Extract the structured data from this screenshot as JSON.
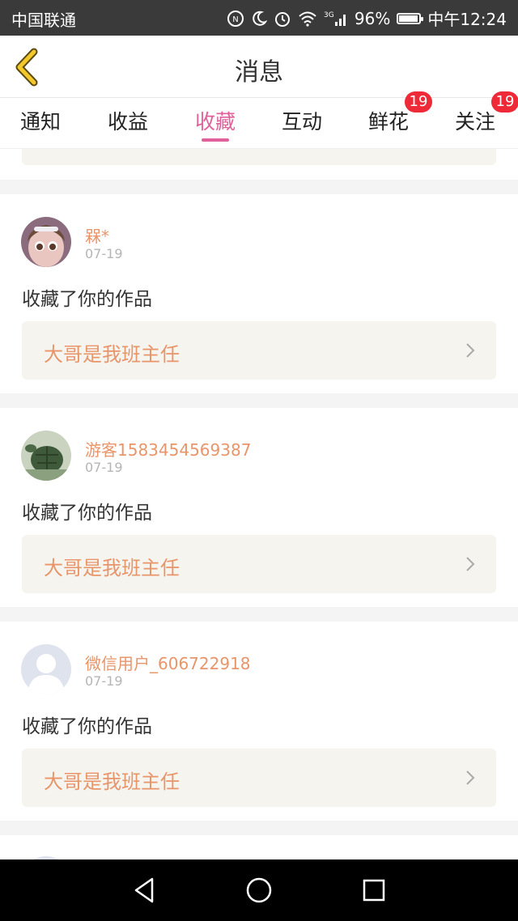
{
  "status_bar": {
    "carrier": "中国联通",
    "network": "3G",
    "battery": "96%",
    "battery_level": 0.96,
    "time": "中午12:24"
  },
  "header": {
    "title": "消息"
  },
  "tabs": [
    {
      "label": "通知",
      "badge": ""
    },
    {
      "label": "收益",
      "badge": ""
    },
    {
      "label": "收藏",
      "badge": "",
      "active": true
    },
    {
      "label": "互动",
      "badge": ""
    },
    {
      "label": "鲜花",
      "badge": "19"
    },
    {
      "label": "关注",
      "badge": "19"
    }
  ],
  "messages": [
    {
      "username": "槑*",
      "date": "07-19",
      "text": "收藏了你的作品",
      "work_title": "大哥是我班主任",
      "avatar": "doll"
    },
    {
      "username": "游客1583454569387",
      "date": "07-19",
      "text": "收藏了你的作品",
      "work_title": "大哥是我班主任",
      "avatar": "turtle"
    },
    {
      "username": "微信用户_606722918",
      "date": "07-19",
      "text": "收藏了你的作品",
      "work_title": "大哥是我班主任",
      "avatar": "default-user"
    }
  ],
  "colors": {
    "accent": "#e0609a",
    "username": "#e8956a",
    "badge": "#ee2a38"
  }
}
